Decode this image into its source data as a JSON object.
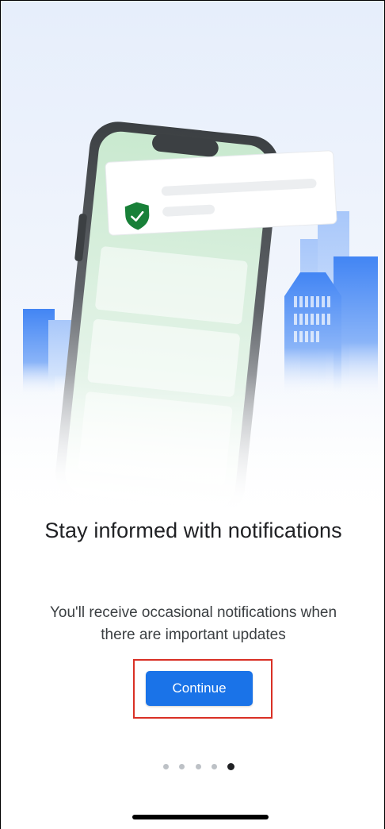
{
  "onboarding": {
    "title": "Stay informed with notifications",
    "subtitle": "You'll receive occasional notifications when there are important updates",
    "continue_label": "Continue"
  },
  "pager": {
    "total_pages": 5,
    "current_page": 5
  },
  "colors": {
    "accent": "#1a73e8",
    "shield": "#188038",
    "highlight": "#d93025"
  }
}
